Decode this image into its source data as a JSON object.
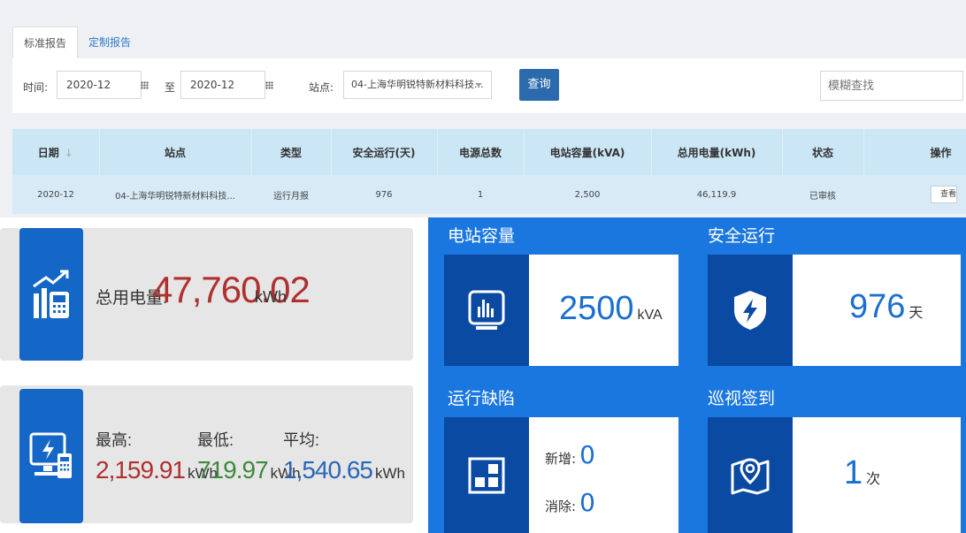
{
  "tabs": [
    {
      "label": "标准报告",
      "active": true
    },
    {
      "label": "定制报告",
      "active": false
    }
  ],
  "filters": {
    "time_label": "时间:",
    "start_date": "2020-12",
    "to_label": "至",
    "end_date": "2020-12",
    "station_label": "站点:",
    "station_value": "04-上海华明锐特新材料科技...",
    "query_button": "查询",
    "search_placeholder": "模糊查找"
  },
  "table": {
    "headers": [
      "日期",
      "站点",
      "类型",
      "安全运行(天)",
      "电源总数",
      "电站容量(kVA)",
      "总用电量(kWh)",
      "状态",
      "操作"
    ],
    "rows": [
      [
        "2020-12",
        "04-上海华明锐特新材料科技...",
        "运行月报",
        "976",
        "1",
        "2,500",
        "46,119.9",
        "已审核",
        "查看"
      ]
    ]
  },
  "total": {
    "label": "总用电量:",
    "value": "47,760.02",
    "unit": "kWh"
  },
  "stats": {
    "max": {
      "label": "最高:",
      "value": "2,159.91",
      "unit": "kWh",
      "color": "#b03030"
    },
    "min": {
      "label": "最低:",
      "value": "719.97",
      "unit": "kWh",
      "color": "#3d8a3d"
    },
    "avg": {
      "label": "平均:",
      "value": "1,540.65",
      "unit": "kWh",
      "color": "#2a66b8"
    }
  },
  "panels": {
    "capacity": {
      "title": "电站容量",
      "value": "2500",
      "unit": "kVA"
    },
    "safety": {
      "title": "安全运行",
      "value": "976",
      "unit": "天"
    },
    "defects": {
      "title": "运行缺陷",
      "new_label": "新增:",
      "new_value": "0",
      "cleared_label": "消除:",
      "cleared_value": "0"
    },
    "patrol": {
      "title": "巡视签到",
      "value": "1",
      "unit": "次"
    }
  },
  "colors": {
    "accent_blue": "#1b77e0",
    "icon_blue": "#1467c6",
    "dark_blue": "#0a4aa3",
    "button_blue": "#2b6aad"
  }
}
